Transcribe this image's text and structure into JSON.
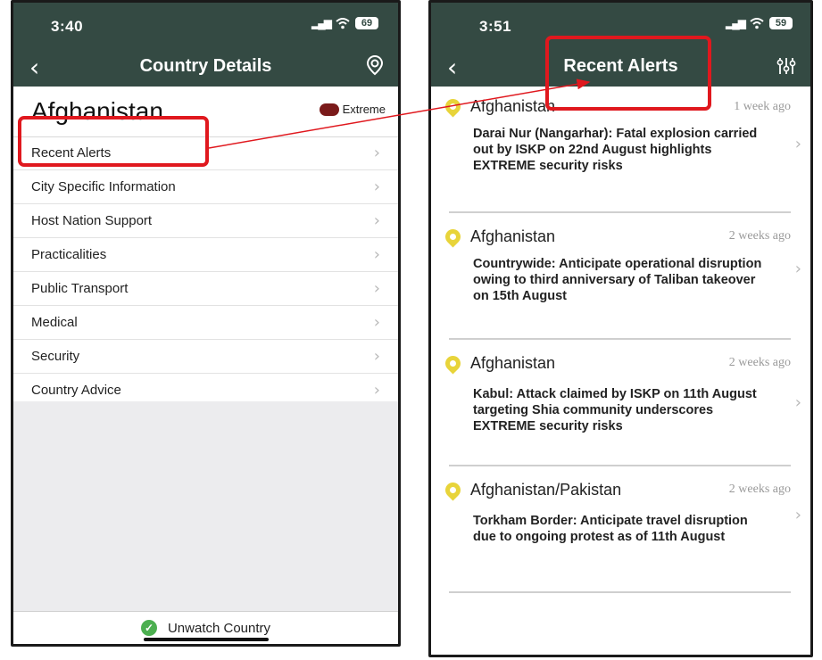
{
  "left_screen": {
    "status": {
      "time": "3:40",
      "battery": "69"
    },
    "nav": {
      "back": "‹",
      "title": "Country Details"
    },
    "country": {
      "name": "Afghanistan",
      "risk_level": "Extreme",
      "risk_color": "#7a1a1a"
    },
    "menu_items": [
      {
        "label": "Recent Alerts"
      },
      {
        "label": "City Specific Information"
      },
      {
        "label": "Host Nation Support"
      },
      {
        "label": "Practicalities"
      },
      {
        "label": "Public Transport"
      },
      {
        "label": "Medical"
      },
      {
        "label": "Security"
      },
      {
        "label": "Country Advice"
      }
    ],
    "footer": {
      "label": "Unwatch Country"
    }
  },
  "right_screen": {
    "status": {
      "time": "3:51",
      "battery": "59"
    },
    "nav": {
      "back": "‹",
      "title": "Recent Alerts"
    },
    "alerts": [
      {
        "country": "Afghanistan",
        "time": "1 week ago",
        "text": "Darai Nur (Nangarhar): Fatal explosion carried out by ISKP on 22nd August highlights EXTREME security risks"
      },
      {
        "country": "Afghanistan",
        "time": "2 weeks ago",
        "text": "Countrywide: Anticipate operational disruption owing to third anniversary of Taliban takeover on 15th August"
      },
      {
        "country": "Afghanistan",
        "time": "2 weeks ago",
        "text": "Kabul: Attack claimed by ISKP on 11th August targeting Shia community underscores EXTREME security risks"
      },
      {
        "country": "Afghanistan/Pakistan",
        "time": "2 weeks ago",
        "text": "Torkham Border: Anticipate travel disruption due to ongoing protest as of 11th August"
      }
    ]
  },
  "theme": {
    "header_color": "#344a43",
    "annotation_color": "#e0181e",
    "pin_color": "#e8d43a"
  },
  "icons": {
    "chevron": "›",
    "location": "location-pin-icon",
    "filter": "filter-sliders-icon"
  }
}
